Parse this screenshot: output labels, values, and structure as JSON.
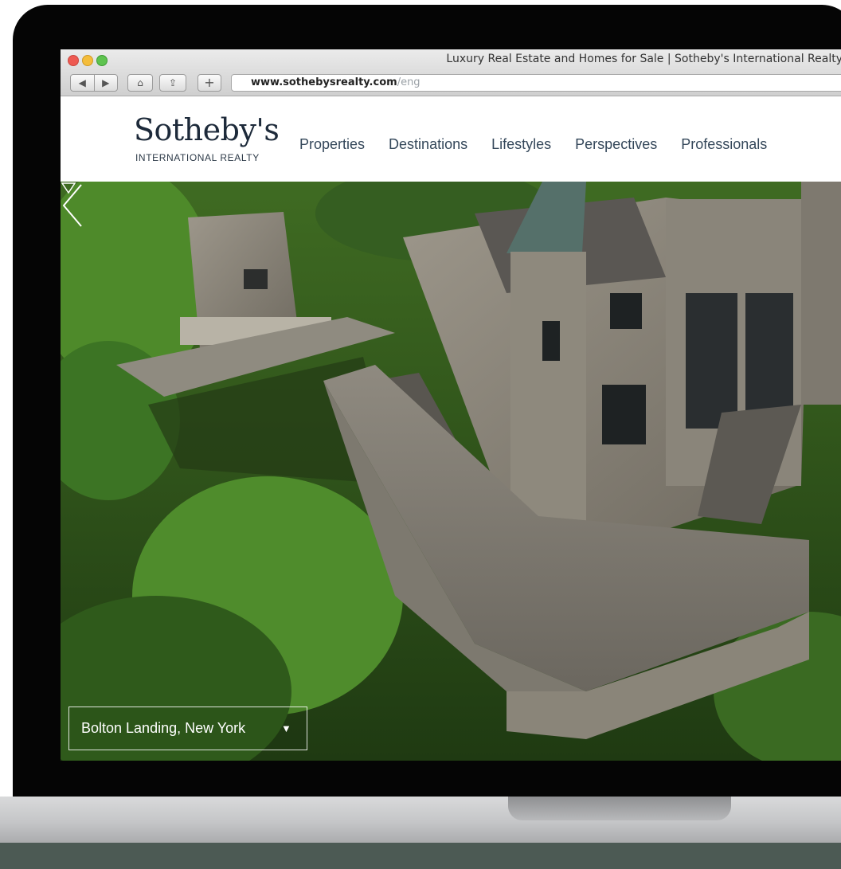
{
  "browser": {
    "window_title": "Luxury Real Estate and Homes for Sale | Sotheby's International Realty",
    "back_glyph": "◀",
    "forward_glyph": "▶",
    "home_glyph": "⌂",
    "share_glyph": "⇪",
    "add_glyph": "+",
    "url_host": "www.sothebysrealty.com",
    "url_path": "/eng"
  },
  "site": {
    "logo_name": "Sotheby's",
    "logo_tagline": "INTERNATIONAL REALTY",
    "nav": [
      "Properties",
      "Destinations",
      "Lifestyles",
      "Perspectives",
      "Professionals"
    ]
  },
  "hero": {
    "location": "Bolton Landing, New York",
    "location_caret": "▼"
  },
  "colors": {
    "logo_navy": "#1d2a3a",
    "nav_text": "#34475a",
    "bezel": "#050505"
  },
  "icons": [
    "back-icon",
    "forward-icon",
    "home-icon",
    "share-icon",
    "add-tab-icon",
    "prev-slide-icon",
    "scroll-down-icon",
    "caret-down-icon"
  ]
}
